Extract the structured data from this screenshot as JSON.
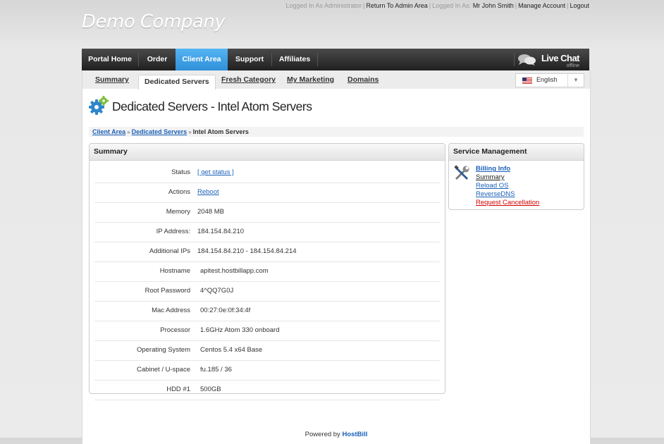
{
  "topbar": {
    "logged_in_admin": "Logged In As Administrator",
    "return_admin": "Return To Admin Area",
    "logged_in_as": "Logged In As:",
    "user_name": "Mr John Smith",
    "manage_account": "Manage Account",
    "logout": "Logout"
  },
  "brand": {
    "company": "Demo Company"
  },
  "nav": {
    "items": [
      {
        "label": "Portal Home"
      },
      {
        "label": "Order"
      },
      {
        "label": "Client Area",
        "active": true
      },
      {
        "label": "Support"
      },
      {
        "label": "Affiliates"
      }
    ],
    "live_chat": {
      "label": "Live Chat",
      "status": "offline"
    }
  },
  "subtabs": {
    "items": [
      {
        "label": "Summary"
      },
      {
        "label": "Dedicated Servers",
        "active": true
      },
      {
        "label": "Fresh Category"
      },
      {
        "label": "My Marketing"
      },
      {
        "label": "Domains"
      }
    ]
  },
  "language": {
    "selected": "English",
    "icon": "us-flag-icon"
  },
  "page": {
    "title": "Dedicated Servers - Intel Atom Servers"
  },
  "breadcrumb": {
    "items": [
      "Client Area",
      "Dedicated Servers"
    ],
    "current": "Intel Atom Servers",
    "separator": "»"
  },
  "summary": {
    "title": "Summary",
    "rows": [
      {
        "label": "Status",
        "value": "[ get status ]",
        "link": true
      },
      {
        "label": "Actions",
        "value": "Reboot",
        "link": true
      },
      {
        "label": "Memory",
        "value": "2048 MB"
      },
      {
        "label": "IP Address:",
        "value": "184.154.84.210"
      },
      {
        "label": "Additional IPs",
        "value": "184.154.84.210 - 184.154.84.214"
      },
      {
        "label": "Hostname",
        "value": "apitest.hostbillapp.com"
      },
      {
        "label": "Root Password",
        "value": "4^QQ7G0J"
      },
      {
        "label": "Mac Address",
        "value": "00:27:0e:0f:34:4f"
      },
      {
        "label": "Processor",
        "value": "1.6GHz Atom 330 onboard"
      },
      {
        "label": "Operating System",
        "value": "Centos 5.4 x64 Base"
      },
      {
        "label": "Cabinet / U-space",
        "value": "fu.185 / 36"
      },
      {
        "label": "HDD #1",
        "value": "500GB"
      }
    ]
  },
  "service_management": {
    "title": "Service Management",
    "links": {
      "billing_info": "Billing Info",
      "summary": "Summary",
      "reload_os": "Reload OS",
      "reverse_dns": "ReverseDNS",
      "request_cancellation": "Request Cancellation"
    }
  },
  "footer": {
    "powered_by": "Powered by",
    "brand": "HostBill"
  },
  "colors": {
    "nav_active": "#3fa0e4",
    "link": "#1b60b8",
    "danger": "#d20000"
  }
}
